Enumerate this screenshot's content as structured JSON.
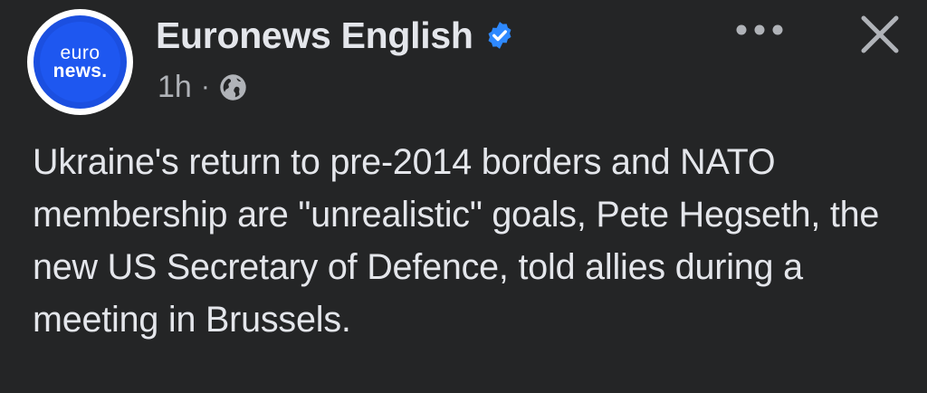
{
  "post": {
    "author": {
      "name": "Euronews English",
      "avatar_line1": "euro",
      "avatar_line2": "news.",
      "verified": true
    },
    "meta": {
      "time": "1h",
      "separator": "·",
      "audience_icon": "globe-icon"
    },
    "actions": {
      "more_icon": "more-options-icon",
      "close_icon": "close-icon"
    },
    "text": "Ukraine's return to pre-2014 borders and NATO membership are \"unrealistic\" goals, Pete Hegseth, the new US Secretary of Defence, told allies during a meeting in Brussels."
  },
  "colors": {
    "background": "#242526",
    "primary_text": "#e4e6eb",
    "secondary_text": "#b0b3b8",
    "verified_blue": "#2e89ff",
    "brand_blue": "#1e57f0"
  }
}
